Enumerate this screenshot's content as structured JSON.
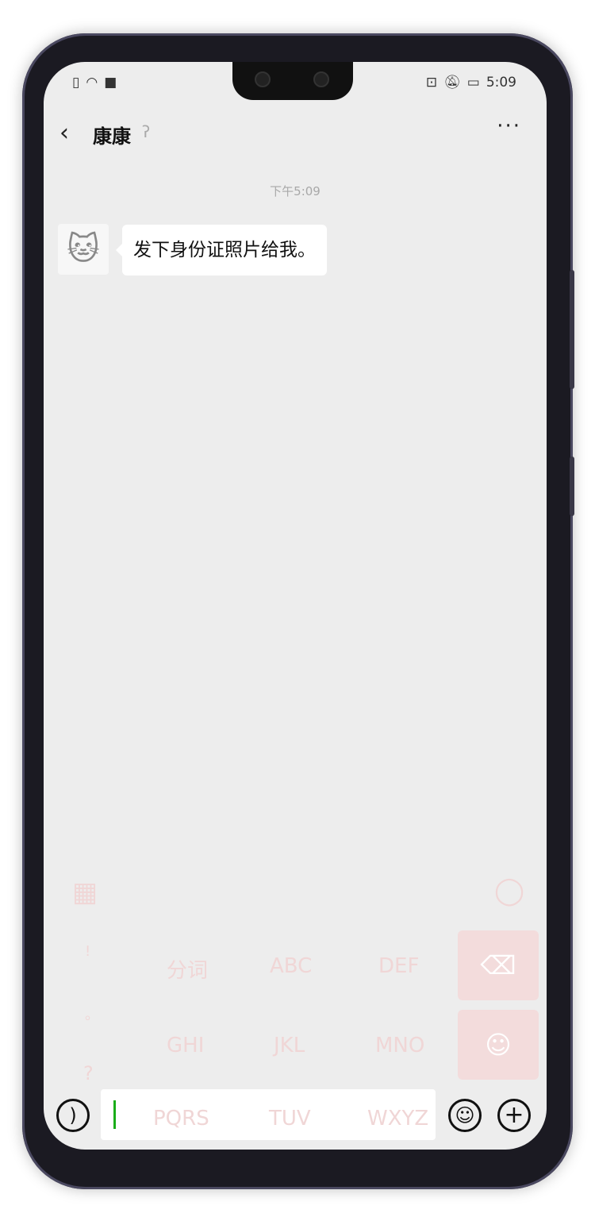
{
  "status_bar": {
    "time": "5:09",
    "left_icons": [
      "sim-alert-icon",
      "wifi-icon",
      "video-icon"
    ],
    "right_icons": [
      "cast-icon",
      "bell-off-icon",
      "battery-charging-icon"
    ]
  },
  "header": {
    "title": "康康",
    "earpiece_icon": "ear-icon",
    "more_label": "···"
  },
  "chat": {
    "timestamp": "下午5:09",
    "messages": [
      {
        "sender": "康康",
        "text": "发下身份证照片给我。"
      }
    ]
  },
  "keyboard_ghost": {
    "keys": [
      "分词",
      "ABC",
      "DEF",
      "GHI",
      "JKL",
      "MNO",
      "PQRS",
      "TUV",
      "WXYZ"
    ],
    "punct": [
      "!",
      "。",
      "?"
    ]
  },
  "input_bar": {
    "value": "",
    "voice_icon": "voice-icon",
    "emoji_icon": "emoji-icon",
    "plus_icon": "plus-icon",
    "accent": "#1aad19"
  }
}
